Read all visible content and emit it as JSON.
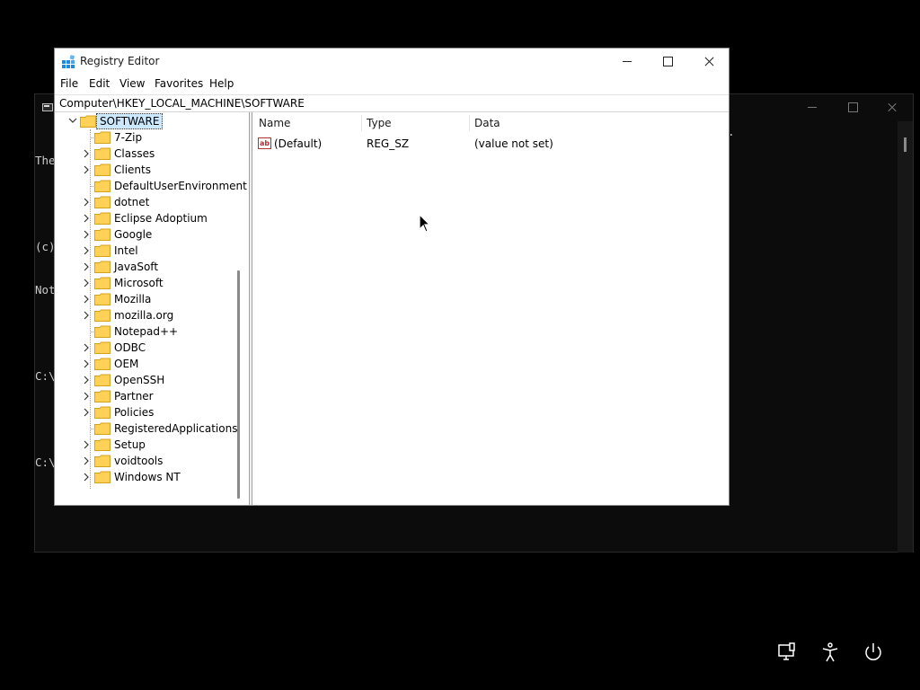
{
  "console": {
    "lines": [
      "The",
      "",
      "(c)",
      "Not",
      "",
      "C:\\",
      "",
      "C:\\"
    ],
    "tail": "."
  },
  "regedit": {
    "title": "Registry Editor",
    "menu": [
      "File",
      "Edit",
      "View",
      "Favorites",
      "Help"
    ],
    "address": "Computer\\HKEY_LOCAL_MACHINE\\SOFTWARE",
    "tree": {
      "selected": "SOFTWARE",
      "children": [
        {
          "label": "7-Zip",
          "expandable": false
        },
        {
          "label": "Classes",
          "expandable": true
        },
        {
          "label": "Clients",
          "expandable": true
        },
        {
          "label": "DefaultUserEnvironment",
          "expandable": false
        },
        {
          "label": "dotnet",
          "expandable": true
        },
        {
          "label": "Eclipse Adoptium",
          "expandable": true
        },
        {
          "label": "Google",
          "expandable": true
        },
        {
          "label": "Intel",
          "expandable": true
        },
        {
          "label": "JavaSoft",
          "expandable": true
        },
        {
          "label": "Microsoft",
          "expandable": true
        },
        {
          "label": "Mozilla",
          "expandable": true
        },
        {
          "label": "mozilla.org",
          "expandable": true
        },
        {
          "label": "Notepad++",
          "expandable": false
        },
        {
          "label": "ODBC",
          "expandable": true
        },
        {
          "label": "OEM",
          "expandable": true
        },
        {
          "label": "OpenSSH",
          "expandable": true
        },
        {
          "label": "Partner",
          "expandable": true
        },
        {
          "label": "Policies",
          "expandable": true
        },
        {
          "label": "RegisteredApplications",
          "expandable": false
        },
        {
          "label": "Setup",
          "expandable": true
        },
        {
          "label": "voidtools",
          "expandable": true
        },
        {
          "label": "Windows NT",
          "expandable": true
        }
      ]
    },
    "columns": {
      "name": "Name",
      "type": "Type",
      "data": "Data"
    },
    "values": [
      {
        "name": "(Default)",
        "type": "REG_SZ",
        "data": "(value not set)",
        "icon": "string-value-icon",
        "icon_text": "ab"
      }
    ]
  },
  "colors": {
    "selection": "#cce8ff",
    "folder": "#ffd257",
    "string_icon": "#b03030"
  },
  "lockscreen_icons": [
    "network-icon",
    "accessibility-icon",
    "power-icon"
  ]
}
